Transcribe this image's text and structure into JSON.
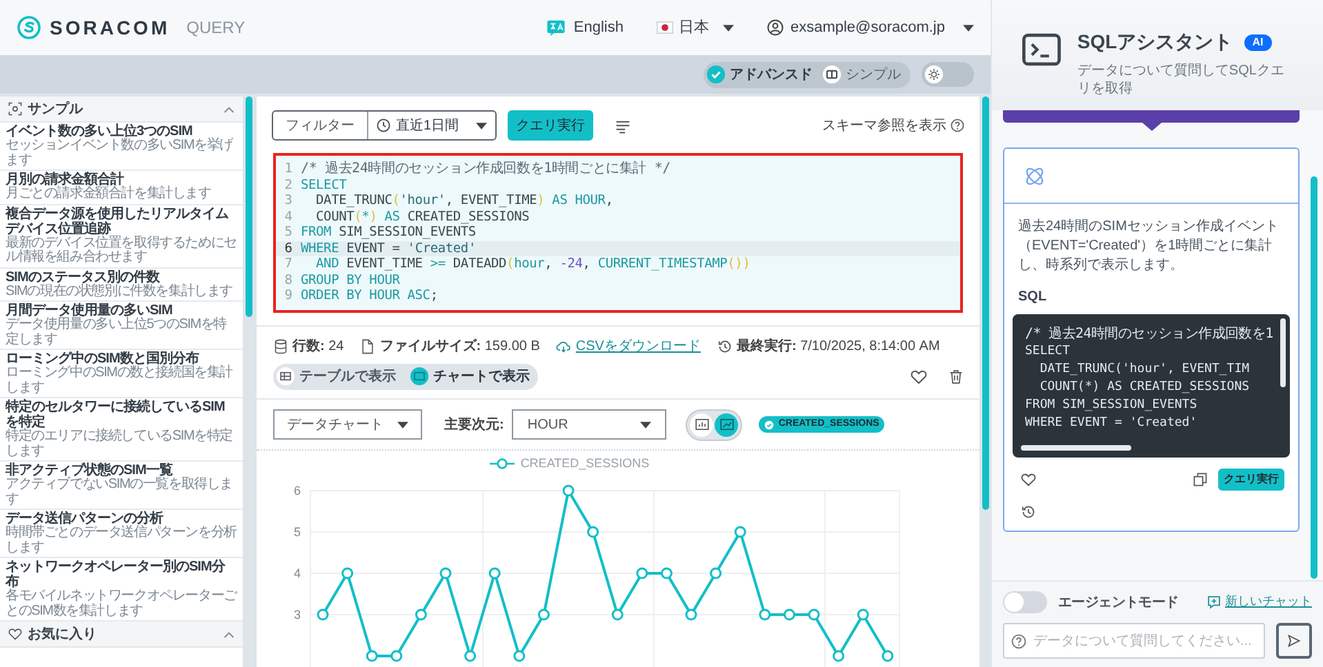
{
  "header": {
    "logo": "SORACOM",
    "product": "QUERY",
    "language": "English",
    "region": "日本",
    "user": "exsample@soracom.jp"
  },
  "mode_toggle": [
    {
      "label": "アドバンスド",
      "selected": true
    },
    {
      "label": "シンプル",
      "selected": false
    }
  ],
  "theme_toggle": {
    "on": false
  },
  "sidebar": {
    "sections": [
      {
        "title": "サンプル",
        "expanded": true,
        "items": [
          {
            "title": "イベント数の多い上位3つのSIM",
            "description": "セッションイベント数の多いSIMを挙げます"
          },
          {
            "title": "月別の請求金額合計",
            "description": "月ごとの請求金額合計を集計します"
          },
          {
            "title": "複合データ源を使用したリアルタイムデバイス位置追跡",
            "description": "最新のデバイス位置を取得するためにセル情報を組み合わせます"
          },
          {
            "title": "SIMのステータス別の件数",
            "description": "SIMの現在の状態別に件数を集計します"
          },
          {
            "title": "月間データ使用量の多いSIM",
            "description": "データ使用量の多い上位5つのSIMを特定します"
          },
          {
            "title": "ローミング中のSIM数と国別分布",
            "description": "ローミング中のSIMの数と接続国を集計します"
          },
          {
            "title": "特定のセルタワーに接続しているSIMを特定",
            "description": "特定のエリアに接続しているSIMを特定します"
          },
          {
            "title": "非アクティブ状態のSIM一覧",
            "description": "アクティブでないSIMの一覧を取得します"
          },
          {
            "title": "データ送信パターンの分析",
            "description": "時間帯ごとのデータ送信パターンを分析します"
          },
          {
            "title": "ネットワークオペレーター別のSIM分布",
            "description": "各モバイルネットワークオペレーターごとのSIM数を集計します"
          }
        ]
      },
      {
        "title": "お気に入り",
        "expanded": true
      }
    ]
  },
  "toolbar": {
    "filter": "フィルター",
    "time_range": "直近1日間",
    "run_button": "クエリ実行",
    "schema_link": "スキーマ参照を表示"
  },
  "editor": {
    "lines": [
      {
        "number": "1",
        "current": false,
        "tokens": [
          {
            "kind": "comment",
            "text": "/* 過去24時間のセッション作成回数を1時間ごとに集計 */"
          }
        ]
      },
      {
        "number": "2",
        "current": false,
        "tokens": [
          {
            "kind": "keyword",
            "text": "SELECT"
          }
        ]
      },
      {
        "number": "3",
        "current": false,
        "tokens": [
          {
            "kind": "plain",
            "text": "  DATE_TRUNC"
          },
          {
            "kind": "paren",
            "text": "("
          },
          {
            "kind": "string",
            "text": "'hour'"
          },
          {
            "kind": "plain",
            "text": ", EVENT_TIME"
          },
          {
            "kind": "paren",
            "text": ")"
          },
          {
            "kind": "keyword",
            "text": " AS HOUR"
          },
          {
            "kind": "plain",
            "text": ","
          }
        ]
      },
      {
        "number": "4",
        "current": false,
        "tokens": [
          {
            "kind": "plain",
            "text": "  COUNT"
          },
          {
            "kind": "paren",
            "text": "("
          },
          {
            "kind": "keyword",
            "text": "*"
          },
          {
            "kind": "paren",
            "text": ")"
          },
          {
            "kind": "keyword",
            "text": " AS"
          },
          {
            "kind": "plain",
            "text": " CREATED_SESSIONS"
          }
        ]
      },
      {
        "number": "5",
        "current": false,
        "tokens": [
          {
            "kind": "keyword",
            "text": "FROM"
          },
          {
            "kind": "plain",
            "text": " SIM_SESSION_EVENTS"
          }
        ]
      },
      {
        "number": "6",
        "current": true,
        "tokens": [
          {
            "kind": "keyword",
            "text": "WHERE"
          },
          {
            "kind": "plain",
            "text": " EVENT = "
          },
          {
            "kind": "string",
            "text": "'Created'"
          }
        ]
      },
      {
        "number": "7",
        "current": false,
        "tokens": [
          {
            "kind": "keyword",
            "text": "  AND"
          },
          {
            "kind": "plain",
            "text": " EVENT_TIME "
          },
          {
            "kind": "keyword",
            "text": ">="
          },
          {
            "kind": "plain",
            "text": " DATEADD"
          },
          {
            "kind": "paren",
            "text": "("
          },
          {
            "kind": "keyword",
            "text": "hour"
          },
          {
            "kind": "plain",
            "text": ", "
          },
          {
            "kind": "number",
            "text": "-24"
          },
          {
            "kind": "plain",
            "text": ", "
          },
          {
            "kind": "keyword",
            "text": "CURRENT_TIMESTAMP"
          },
          {
            "kind": "paren",
            "text": "())"
          }
        ]
      },
      {
        "number": "8",
        "current": false,
        "tokens": [
          {
            "kind": "keyword",
            "text": "GROUP BY HOUR"
          }
        ]
      },
      {
        "number": "9",
        "current": false,
        "tokens": [
          {
            "kind": "keyword",
            "text": "ORDER BY HOUR ASC"
          },
          {
            "kind": "plain",
            "text": ";"
          }
        ]
      }
    ]
  },
  "stats": [
    {
      "kind": "rows",
      "text": "**行数:** 24"
    },
    {
      "kind": "size",
      "text": "**ファイルサイズ:** 159.00 B"
    },
    {
      "kind": "download",
      "text": "CSVをダウンロード"
    },
    {
      "kind": "last_run",
      "text": "**最終実行:** 7/10/2025, 8:14:00 AM"
    }
  ],
  "view_tabs": [
    {
      "label": "テーブルで表示",
      "selected": false
    },
    {
      "label": "チャートで表示",
      "selected": true
    }
  ],
  "chart_controls": {
    "chart_type": "データチャート",
    "dimension_label": "主要次元:",
    "dimension": "HOUR",
    "chart_style": [
      {
        "kind": "bar",
        "selected": false
      },
      {
        "kind": "line",
        "selected": true
      }
    ],
    "series_chips": [
      {
        "label": "CREATED_SESSIONS",
        "selected": true
      }
    ]
  },
  "chart": {
    "chart_data": {
      "type": "line",
      "ylim": [
        0,
        6
      ],
      "yticks": [
        3,
        4,
        5,
        6
      ],
      "grid": true,
      "series": [
        {
          "name": "CREATED_SESSIONS",
          "color": "#13bfc7",
          "marker": "circle",
          "values": [
            3,
            4,
            2,
            2,
            3,
            4,
            2,
            4,
            2,
            3,
            6,
            5,
            3,
            4,
            4,
            3,
            4,
            5,
            3,
            3,
            3,
            2,
            3,
            2
          ]
        }
      ]
    }
  },
  "assistant": {
    "title": "SQLアシスタント",
    "badge": "AI",
    "subtitle": "データについて質問してSQLクエリを取得",
    "response": {
      "description": "過去24時間のSIMセッション作成イベント（EVENT='Created'）を1時間ごとに集計し、時系列で表示します。",
      "sql_label": "SQL",
      "sql_lines": [
        "/* 過去24時間のセッション作成回数を1",
        "SELECT",
        "  DATE_TRUNC('hour', EVENT_TIM",
        "  COUNT(*) AS CREATED_SESSIONS",
        "FROM SIM_SESSION_EVENTS",
        "WHERE EVENT = 'Created'"
      ],
      "run_button": "クエリ実行"
    },
    "agent_mode": {
      "label": "エージェントモード",
      "on": false
    },
    "new_chat": "新しいチャット",
    "input": {
      "placeholder": "データについて質問してください..."
    }
  }
}
